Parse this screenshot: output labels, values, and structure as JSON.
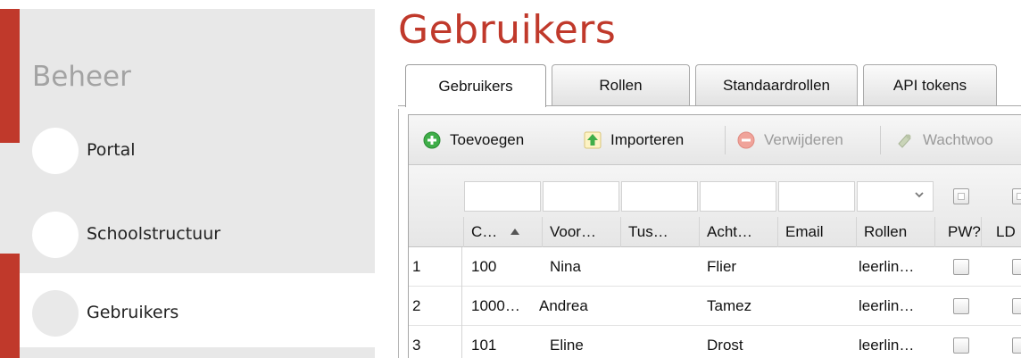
{
  "sidebar": {
    "title": "Beheer",
    "items": [
      {
        "label": "Portal"
      },
      {
        "label": "Schoolstructuur"
      },
      {
        "label": "Gebruikers"
      }
    ]
  },
  "page": {
    "title": "Gebruikers"
  },
  "tabs": [
    {
      "label": "Gebruikers"
    },
    {
      "label": "Rollen"
    },
    {
      "label": "Standaardrollen"
    },
    {
      "label": "API tokens"
    }
  ],
  "toolbar": {
    "add_label": "Toevoegen",
    "import_label": "Importeren",
    "delete_label": "Verwijderen",
    "password_label": "Wachtwoo"
  },
  "columns": [
    {
      "label": "C…"
    },
    {
      "label": "Voor…"
    },
    {
      "label": "Tus…"
    },
    {
      "label": "Acht…"
    },
    {
      "label": "Email"
    },
    {
      "label": "Rollen"
    },
    {
      "label": "PW?"
    },
    {
      "label": "LD"
    }
  ],
  "rows": [
    {
      "num": "1",
      "code": "100",
      "first": "Nina",
      "middle": "",
      "last": "Flier",
      "email": "",
      "roles": "leerlin…"
    },
    {
      "num": "2",
      "code": "1000…",
      "first": "Andrea",
      "middle": "",
      "last": "Tamez",
      "email": "",
      "roles": "leerlin…"
    },
    {
      "num": "3",
      "code": "101",
      "first": "Eline",
      "middle": "",
      "last": "Drost",
      "email": "",
      "roles": "leerlin…"
    }
  ],
  "colors": {
    "accent": "#c0392b",
    "sidebar_bg": "#e8e8e8"
  }
}
